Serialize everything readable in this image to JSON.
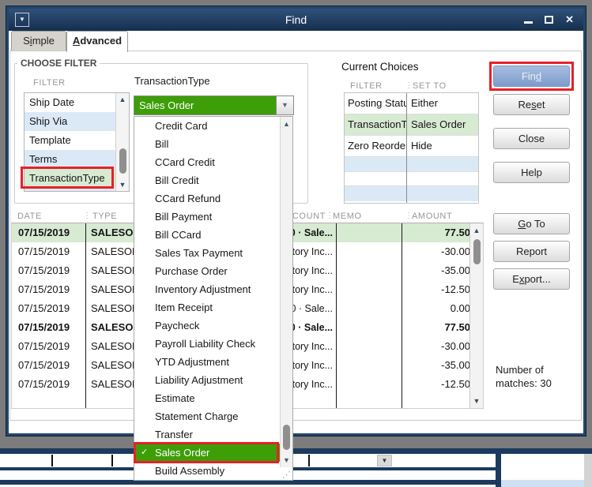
{
  "window": {
    "title": "Find"
  },
  "icons": {
    "window_menu": "▼",
    "close": "✕",
    "combo_arrow": "▼",
    "scroll_up": "▲",
    "scroll_down": "▼",
    "checkmark": "✓",
    "header_separator": "⋮",
    "resize_grip": "⋰",
    "bg_dropdown_arrow": "▼"
  },
  "tabs": {
    "simple": {
      "pre": "S",
      "key": "i",
      "post": "mple"
    },
    "advanced": {
      "pre": "",
      "key": "A",
      "post": "dvanced"
    }
  },
  "choose_filter": {
    "label": "CHOOSE FILTER",
    "column_label": "FILTER",
    "items": [
      "Ship Date",
      "Ship Via",
      "Template",
      "Terms",
      "TransactionType"
    ],
    "selected_item": "TransactionType"
  },
  "transaction_type": {
    "label": "TransactionType",
    "value": "Sales Order",
    "options": [
      "Credit Card",
      "Bill",
      "CCard Credit",
      "Bill Credit",
      "CCard Refund",
      "Bill Payment",
      "Bill CCard",
      "Sales Tax Payment",
      "Purchase Order",
      "Inventory Adjustment",
      "Item Receipt",
      "Paycheck",
      "Payroll Liability Check",
      "YTD Adjustment",
      "Liability Adjustment",
      "Estimate",
      "Statement Charge",
      "Transfer",
      "Sales Order",
      "Build Assembly"
    ],
    "selected_option": "Sales Order"
  },
  "current_choices": {
    "title": "Current Choices",
    "headers": {
      "filter": "FILTER",
      "set_to": "SET TO"
    },
    "rows": [
      {
        "filter": "Posting Status",
        "set_to": "Either"
      },
      {
        "filter": "TransactionType",
        "set_to": "Sales Order"
      },
      {
        "filter": "Zero Reorder ...",
        "set_to": "Hide"
      }
    ]
  },
  "buttons": {
    "find": {
      "pre": "Fin",
      "key": "d",
      "post": ""
    },
    "reset": {
      "pre": "Re",
      "key": "s",
      "post": "et"
    },
    "close": {
      "pre": "Close",
      "key": "",
      "post": ""
    },
    "help": {
      "pre": "Help",
      "key": "",
      "post": ""
    },
    "go_to": {
      "pre": "",
      "key": "G",
      "post": "o To"
    },
    "report": {
      "pre": "Report",
      "key": "",
      "post": ""
    },
    "export": {
      "pre": "E",
      "key": "x",
      "post": "port..."
    }
  },
  "results": {
    "headers": {
      "date": "DATE",
      "type": "TYPE",
      "account": "ACCOUNT",
      "memo": "MEMO",
      "amount": "AMOUNT"
    },
    "rows": [
      {
        "date": "07/15/2019",
        "type": "SALESOR",
        "account": "0 · Sale...",
        "memo": "",
        "amount": "77.50"
      },
      {
        "date": "07/15/2019",
        "type": "SALESOR",
        "account": "tory Inc...",
        "memo": "",
        "amount": "-30.00"
      },
      {
        "date": "07/15/2019",
        "type": "SALESOR",
        "account": "tory Inc...",
        "memo": "",
        "amount": "-35.00"
      },
      {
        "date": "07/15/2019",
        "type": "SALESOR",
        "account": "tory Inc...",
        "memo": "",
        "amount": "-12.50"
      },
      {
        "date": "07/15/2019",
        "type": "SALESOR",
        "account": "0 · Sale...",
        "memo": "",
        "amount": "0.00"
      },
      {
        "date": "07/15/2019",
        "type": "SALESOR",
        "account": "0 · Sale...",
        "memo": "",
        "amount": "77.50"
      },
      {
        "date": "07/15/2019",
        "type": "SALESOR",
        "account": "tory Inc...",
        "memo": "",
        "amount": "-30.00"
      },
      {
        "date": "07/15/2019",
        "type": "SALESOR",
        "account": "tory Inc...",
        "memo": "",
        "amount": "-35.00"
      },
      {
        "date": "07/15/2019",
        "type": "SALESOR",
        "account": "tory Inc...",
        "memo": "",
        "amount": "-12.50"
      }
    ]
  },
  "matches": {
    "line1": "Number of",
    "line2": "matches: 30"
  },
  "colors": {
    "accent_green": "#3d9e08",
    "selection_green": "#d7ead2",
    "row_blue": "#dbe9f7",
    "annotation_red": "#e62129",
    "titlebar_navy": "#1d3a5c",
    "find_button_blue": "#8aa8d4"
  }
}
